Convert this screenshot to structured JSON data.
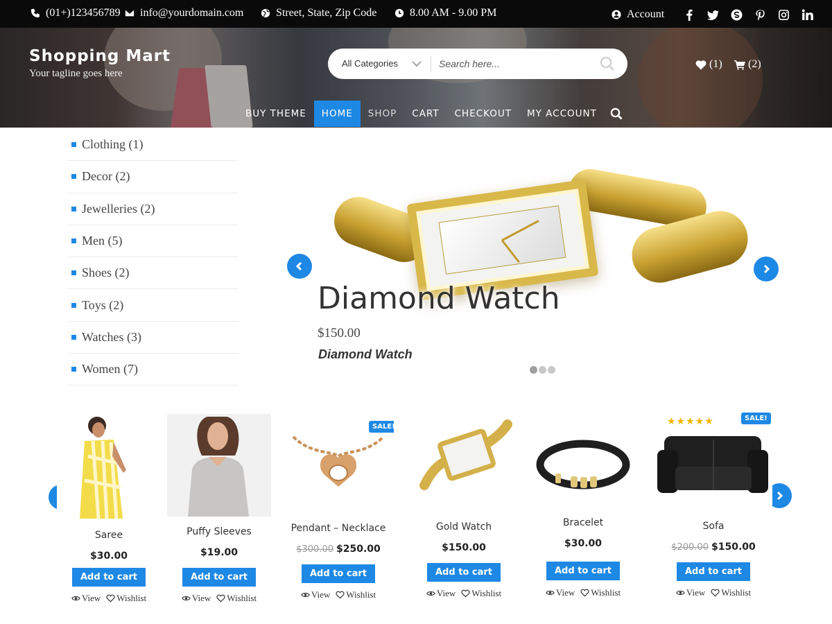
{
  "topbar": {
    "phone": "(01+)123456789",
    "email": "info@yourdomain.com",
    "address": "Street, State, Zip Code",
    "hours": "8.00 AM - 9.00 PM",
    "account": "Account"
  },
  "header": {
    "site_title": "Shopping Mart",
    "tagline": "Your tagline goes here",
    "search_category": "All Categories",
    "search_placeholder": "Search here...",
    "wishlist_count": "(1)",
    "cart_count": "(2)"
  },
  "nav": [
    "BUY THEME",
    "HOME",
    "SHOP",
    "CART",
    "CHECKOUT",
    "MY ACCOUNT"
  ],
  "categories": [
    "Clothing (1)",
    "Decor (2)",
    "Jewelleries (2)",
    "Men (5)",
    "Shoes (2)",
    "Toys (2)",
    "Watches (3)",
    "Women (7)"
  ],
  "slider": {
    "title": "Diamond Watch",
    "price": "$150.00",
    "subtitle": "Diamond Watch",
    "active_slide": 1,
    "slide_count": 3
  },
  "products": [
    {
      "name": "Saree",
      "price": "$30.00",
      "old_price": "",
      "sale": "",
      "rating": 0
    },
    {
      "name": "Puffy Sleeves",
      "price": "$19.00",
      "old_price": "",
      "sale": "",
      "rating": 0
    },
    {
      "name": "Pendant – Necklace",
      "price": "$250.00",
      "old_price": "$300.00",
      "sale": "SALE!",
      "rating": 0
    },
    {
      "name": "Gold Watch",
      "price": "$150.00",
      "old_price": "",
      "sale": "",
      "rating": 0
    },
    {
      "name": "Bracelet",
      "price": "$30.00",
      "old_price": "",
      "sale": "",
      "rating": 0
    },
    {
      "name": "Sofa",
      "price": "$150.00",
      "old_price": "$200.00",
      "sale": "SALE!",
      "rating": 5
    }
  ],
  "product_actions": {
    "add_to_cart": "Add to cart",
    "view": "View",
    "wishlist": "Wishlist"
  },
  "colors": {
    "accent": "#1e88e5",
    "topbar": "#0a0a0a",
    "star": "#f4b400"
  }
}
